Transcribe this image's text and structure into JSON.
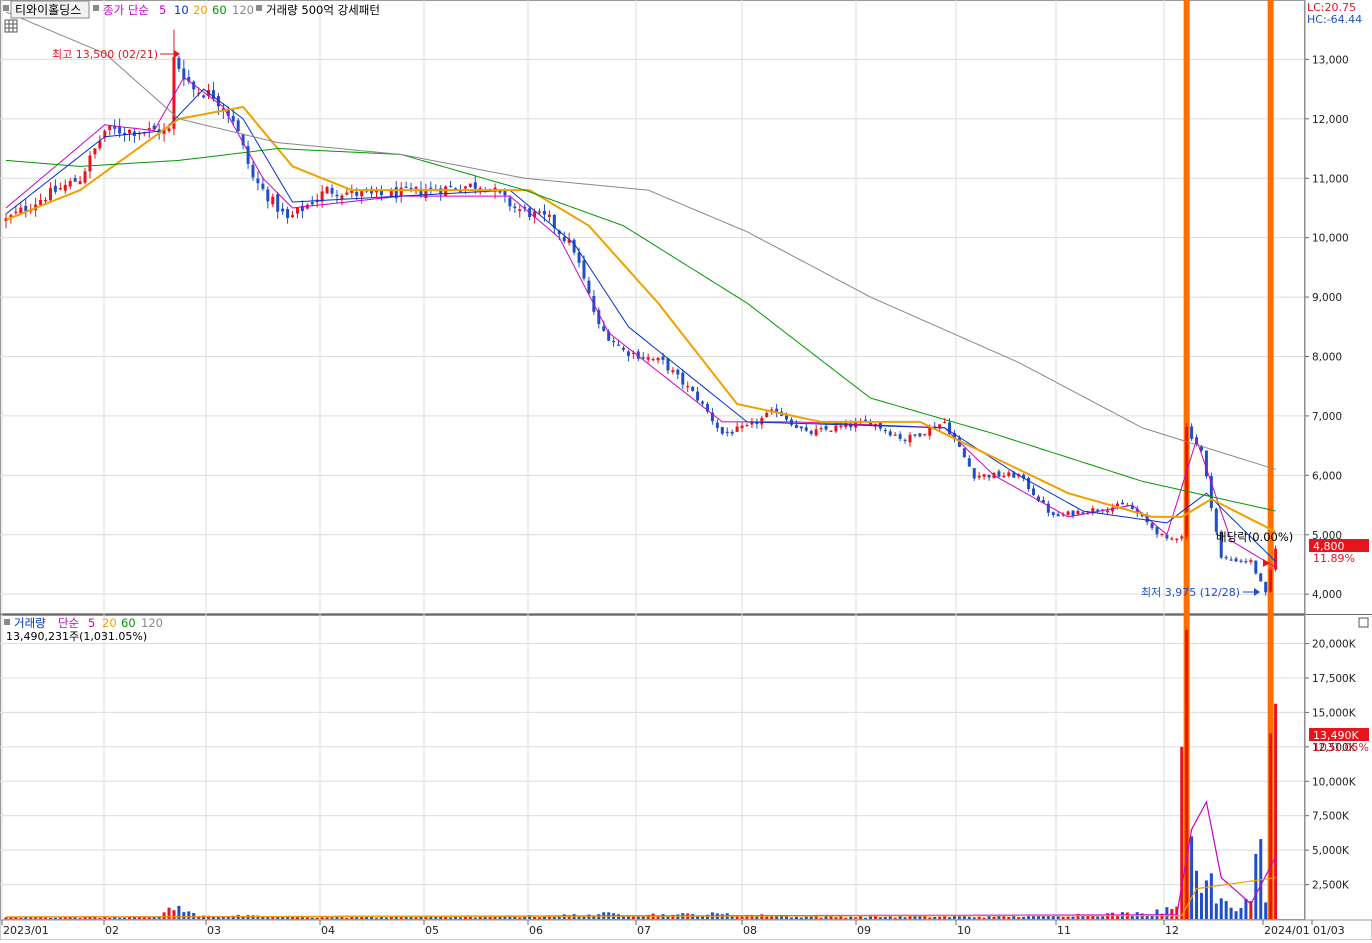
{
  "header": {
    "stock_name": "티와이홀딩스",
    "ma_label": "종가 단순",
    "ma_periods": [
      "5",
      "10",
      "20",
      "60",
      "120"
    ],
    "ma_colors": [
      "#cc00cc",
      "#0033cc",
      "#f0a000",
      "#009900",
      "#888888"
    ],
    "pattern_label": "거래량 500억 강세패턴",
    "lc_label": "LC:20.75",
    "hc_label": "HC:-64.44"
  },
  "volume_header": {
    "title": "거래량",
    "ma_label": "단순",
    "ma_periods": [
      "5",
      "20",
      "60",
      "120"
    ],
    "ma_colors": [
      "#cc00cc",
      "#f0a000",
      "#009900",
      "#888888"
    ],
    "value_text": "13,490,231주(1,031.05%)"
  },
  "annotations": {
    "high": "최고 13,500 (02/21)",
    "low": "최저 3,975 (12/28)",
    "dividend": "배당락(0.00%)"
  },
  "badges": {
    "price": "4,800",
    "price_change": "11.89%",
    "volume": "13,490K",
    "volume_change": "1031.05%"
  },
  "colors": {
    "up": "#e8141c",
    "down": "#1e4fc8",
    "highlight": "#ff6f00",
    "ma5": "#cc00cc",
    "ma10": "#0033cc",
    "ma20": "#f0a000",
    "ma60": "#009900",
    "ma120": "#888888"
  },
  "chart_data": {
    "type": "candlestick",
    "price_axis": {
      "ylim": [
        3700,
        14000
      ],
      "ticks": [
        4000,
        5000,
        6000,
        7000,
        8000,
        9000,
        10000,
        11000,
        12000,
        13000
      ],
      "tick_labels": [
        "4,000",
        "5,000",
        "6,000",
        "7,000",
        "8,000",
        "9,000",
        "10,000",
        "11,000",
        "12,000",
        "13,000"
      ]
    },
    "volume_axis": {
      "ylim": [
        0,
        22000
      ],
      "ticks": [
        2500,
        5000,
        7500,
        10000,
        12500,
        15000,
        17500,
        20000
      ],
      "tick_labels": [
        "2,500K",
        "5,000K",
        "7,500K",
        "10,000K",
        "12,500K",
        "15,000K",
        "17,500K",
        "20,000K"
      ]
    },
    "x_axis": {
      "labels": [
        "2023/01",
        "02",
        "03",
        "04",
        "05",
        "06",
        "07",
        "08",
        "09",
        "10",
        "11",
        "12",
        "2024/01",
        "01/03"
      ]
    },
    "grid": true,
    "price_keypoints": [
      {
        "t": 0,
        "p": 10300
      },
      {
        "t": 8,
        "p": 10700
      },
      {
        "t": 15,
        "p": 11000
      },
      {
        "t": 20,
        "p": 11800
      },
      {
        "t": 27,
        "p": 11800
      },
      {
        "t": 33,
        "p": 11800
      },
      {
        "t": 34,
        "p": 13000
      },
      {
        "t": 38,
        "p": 12500
      },
      {
        "t": 42,
        "p": 12400
      },
      {
        "t": 46,
        "p": 12000
      },
      {
        "t": 50,
        "p": 11000
      },
      {
        "t": 57,
        "p": 10300
      },
      {
        "t": 65,
        "p": 10800
      },
      {
        "t": 75,
        "p": 10700
      },
      {
        "t": 85,
        "p": 10800
      },
      {
        "t": 97,
        "p": 10900
      },
      {
        "t": 103,
        "p": 10500
      },
      {
        "t": 110,
        "p": 10300
      },
      {
        "t": 115,
        "p": 9800
      },
      {
        "t": 120,
        "p": 8500
      },
      {
        "t": 125,
        "p": 8100
      },
      {
        "t": 133,
        "p": 7900
      },
      {
        "t": 140,
        "p": 7300
      },
      {
        "t": 145,
        "p": 6700
      },
      {
        "t": 150,
        "p": 6800
      },
      {
        "t": 156,
        "p": 7100
      },
      {
        "t": 162,
        "p": 6700
      },
      {
        "t": 168,
        "p": 6800
      },
      {
        "t": 175,
        "p": 6900
      },
      {
        "t": 182,
        "p": 6600
      },
      {
        "t": 190,
        "p": 6900
      },
      {
        "t": 196,
        "p": 6000
      },
      {
        "t": 205,
        "p": 6000
      },
      {
        "t": 212,
        "p": 5300
      },
      {
        "t": 218,
        "p": 5400
      },
      {
        "t": 227,
        "p": 5500
      },
      {
        "t": 235,
        "p": 4900
      },
      {
        "t": 238,
        "p": 5000
      },
      {
        "t": 239,
        "p": 6800
      },
      {
        "t": 242,
        "p": 6400
      },
      {
        "t": 246,
        "p": 4600
      },
      {
        "t": 252,
        "p": 4550
      },
      {
        "t": 255,
        "p": 4000
      },
      {
        "t": 257,
        "p": 4800
      }
    ],
    "ma_series": [
      {
        "period": 5,
        "points": [
          {
            "t": 0,
            "p": 10500
          },
          {
            "t": 20,
            "p": 11900
          },
          {
            "t": 30,
            "p": 11800
          },
          {
            "t": 36,
            "p": 12700
          },
          {
            "t": 44,
            "p": 12200
          },
          {
            "t": 52,
            "p": 11000
          },
          {
            "t": 58,
            "p": 10500
          },
          {
            "t": 80,
            "p": 10700
          },
          {
            "t": 102,
            "p": 10700
          },
          {
            "t": 112,
            "p": 10000
          },
          {
            "t": 122,
            "p": 8400
          },
          {
            "t": 145,
            "p": 6900
          },
          {
            "t": 160,
            "p": 6900
          },
          {
            "t": 190,
            "p": 6800
          },
          {
            "t": 200,
            "p": 6000
          },
          {
            "t": 215,
            "p": 5300
          },
          {
            "t": 228,
            "p": 5500
          },
          {
            "t": 235,
            "p": 5000
          },
          {
            "t": 241,
            "p": 6600
          },
          {
            "t": 248,
            "p": 4900
          },
          {
            "t": 257,
            "p": 4450
          }
        ]
      },
      {
        "period": 10,
        "points": [
          {
            "t": 0,
            "p": 10400
          },
          {
            "t": 20,
            "p": 11700
          },
          {
            "t": 32,
            "p": 11800
          },
          {
            "t": 40,
            "p": 12500
          },
          {
            "t": 48,
            "p": 12000
          },
          {
            "t": 58,
            "p": 10600
          },
          {
            "t": 80,
            "p": 10700
          },
          {
            "t": 102,
            "p": 10800
          },
          {
            "t": 115,
            "p": 9900
          },
          {
            "t": 126,
            "p": 8500
          },
          {
            "t": 150,
            "p": 6900
          },
          {
            "t": 190,
            "p": 6800
          },
          {
            "t": 205,
            "p": 6000
          },
          {
            "t": 218,
            "p": 5400
          },
          {
            "t": 235,
            "p": 5200
          },
          {
            "t": 243,
            "p": 5700
          },
          {
            "t": 257,
            "p": 4550
          }
        ]
      },
      {
        "period": 20,
        "points": [
          {
            "t": 0,
            "p": 10300
          },
          {
            "t": 15,
            "p": 10800
          },
          {
            "t": 25,
            "p": 11400
          },
          {
            "t": 35,
            "p": 12000
          },
          {
            "t": 48,
            "p": 12200
          },
          {
            "t": 58,
            "p": 11200
          },
          {
            "t": 70,
            "p": 10800
          },
          {
            "t": 90,
            "p": 10800
          },
          {
            "t": 106,
            "p": 10800
          },
          {
            "t": 118,
            "p": 10200
          },
          {
            "t": 132,
            "p": 8900
          },
          {
            "t": 148,
            "p": 7200
          },
          {
            "t": 165,
            "p": 6900
          },
          {
            "t": 185,
            "p": 6900
          },
          {
            "t": 200,
            "p": 6300
          },
          {
            "t": 215,
            "p": 5700
          },
          {
            "t": 232,
            "p": 5300
          },
          {
            "t": 238,
            "p": 5300
          },
          {
            "t": 244,
            "p": 5600
          },
          {
            "t": 257,
            "p": 5050
          }
        ]
      },
      {
        "period": 60,
        "points": [
          {
            "t": 0,
            "p": 11300
          },
          {
            "t": 15,
            "p": 11200
          },
          {
            "t": 35,
            "p": 11300
          },
          {
            "t": 55,
            "p": 11500
          },
          {
            "t": 80,
            "p": 11400
          },
          {
            "t": 105,
            "p": 10800
          },
          {
            "t": 125,
            "p": 10200
          },
          {
            "t": 150,
            "p": 8900
          },
          {
            "t": 175,
            "p": 7300
          },
          {
            "t": 200,
            "p": 6700
          },
          {
            "t": 230,
            "p": 5900
          },
          {
            "t": 257,
            "p": 5400
          }
        ]
      },
      {
        "period": 120,
        "points": [
          {
            "t": 0,
            "p": 13800
          },
          {
            "t": 20,
            "p": 13100
          },
          {
            "t": 35,
            "p": 12000
          },
          {
            "t": 55,
            "p": 11600
          },
          {
            "t": 80,
            "p": 11400
          },
          {
            "t": 105,
            "p": 11000
          },
          {
            "t": 130,
            "p": 10800
          },
          {
            "t": 150,
            "p": 10100
          },
          {
            "t": 175,
            "p": 9000
          },
          {
            "t": 205,
            "p": 7900
          },
          {
            "t": 230,
            "p": 6800
          },
          {
            "t": 257,
            "p": 6100
          }
        ]
      }
    ],
    "volume_keypoints": [
      {
        "t": 0,
        "v": 120
      },
      {
        "t": 30,
        "v": 140
      },
      {
        "t": 35,
        "v": 950
      },
      {
        "t": 36,
        "v": 500
      },
      {
        "t": 40,
        "v": 250
      },
      {
        "t": 60,
        "v": 130
      },
      {
        "t": 110,
        "v": 200
      },
      {
        "t": 120,
        "v": 350
      },
      {
        "t": 135,
        "v": 300
      },
      {
        "t": 145,
        "v": 350
      },
      {
        "t": 160,
        "v": 160
      },
      {
        "t": 200,
        "v": 160
      },
      {
        "t": 230,
        "v": 400
      },
      {
        "t": 237,
        "v": 900
      },
      {
        "t": 238,
        "v": 12500
      },
      {
        "t": 239,
        "v": 21000
      },
      {
        "t": 240,
        "v": 6000
      },
      {
        "t": 241,
        "v": 3500
      },
      {
        "t": 243,
        "v": 2800
      },
      {
        "t": 246,
        "v": 1500
      },
      {
        "t": 250,
        "v": 800
      },
      {
        "t": 252,
        "v": 1300
      },
      {
        "t": 254,
        "v": 5800
      },
      {
        "t": 255,
        "v": 1200
      },
      {
        "t": 256,
        "v": 13490
      }
    ],
    "volume_ma_series": [
      {
        "period": 5,
        "points": [
          {
            "t": 0,
            "v": 140
          },
          {
            "t": 237,
            "v": 300
          },
          {
            "t": 240,
            "v": 6500
          },
          {
            "t": 243,
            "v": 8500
          },
          {
            "t": 246,
            "v": 3000
          },
          {
            "t": 252,
            "v": 1100
          },
          {
            "t": 257,
            "v": 4500
          }
        ]
      },
      {
        "period": 20,
        "points": [
          {
            "t": 0,
            "v": 150
          },
          {
            "t": 238,
            "v": 250
          },
          {
            "t": 241,
            "v": 2200
          },
          {
            "t": 257,
            "v": 3000
          }
        ]
      }
    ],
    "highlight_bars": [
      239,
      256
    ],
    "last_price": 4800,
    "last_volume": 13490
  }
}
